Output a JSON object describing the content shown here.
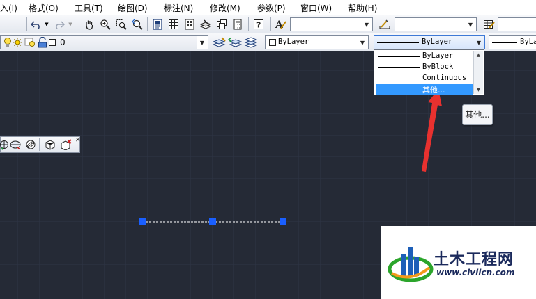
{
  "menubar": {
    "items": [
      "入(I)",
      "格式(O)",
      "工具(T)",
      "绘图(D)",
      "标注(N)",
      "修改(M)",
      "参数(P)",
      "窗口(W)",
      "帮助(H)"
    ]
  },
  "layer_toolbar": {
    "layer_name": "0",
    "color_value": "ByLayer",
    "linetype_value": "ByLayer",
    "lineweight_value": "ByLa"
  },
  "linetype_dropdown": {
    "items": [
      "ByLayer",
      "ByBlock",
      "Continuous",
      "其他..."
    ],
    "selected_index": 3
  },
  "tooltip": {
    "text": "其他..."
  },
  "watermark": {
    "brand": "土木工程网",
    "url": "www.civilcn.com"
  },
  "colors": {
    "canvas_bg": "#252a36",
    "grid_line": "#2e3444",
    "selection_blue": "#3399ff",
    "grip_blue": "#1a5fff",
    "arrow_red": "#e8312f"
  },
  "icons": [
    "undo-icon",
    "redo-icon",
    "pan-icon",
    "zoom-realtime-icon",
    "zoom-window-icon",
    "zoom-previous-icon",
    "properties-icon",
    "design-center-icon",
    "tool-palettes-icon",
    "sheet-set-icon",
    "markup-icon",
    "calculator-icon",
    "help-icon",
    "text-style-icon",
    "dim-style-icon",
    "table-style-icon",
    "layer-state-icon",
    "layer-previous-icon",
    "layer-match-icon",
    "lightbulb-icon",
    "sun-icon",
    "lock-icon",
    "view-icon",
    "view-front-icon",
    "orbit-icon",
    "box-icon",
    "close-icon"
  ]
}
